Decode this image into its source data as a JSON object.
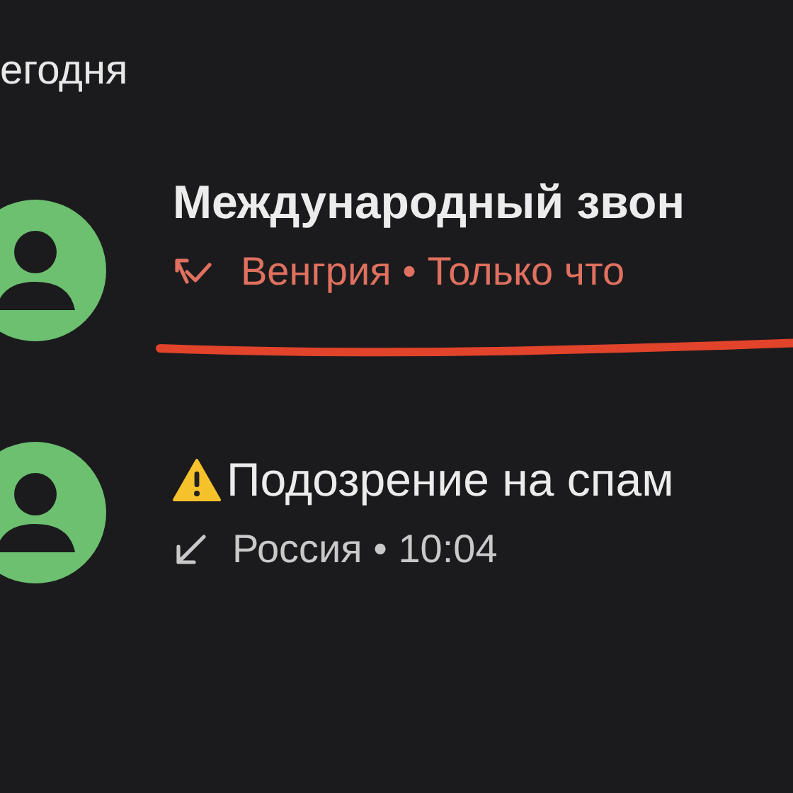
{
  "section_title": "егодня",
  "calls": [
    {
      "name": "Международный звон",
      "name_bold": true,
      "kind": "missed",
      "spam_warning": false,
      "country": "Венгрия",
      "separator": "•",
      "time": "Только что",
      "underlined": true
    },
    {
      "name": "Подозрение на спам",
      "name_bold": false,
      "kind": "incoming",
      "spam_warning": true,
      "country": "Россия",
      "separator": "•",
      "time": "10:04",
      "underlined": false
    }
  ]
}
